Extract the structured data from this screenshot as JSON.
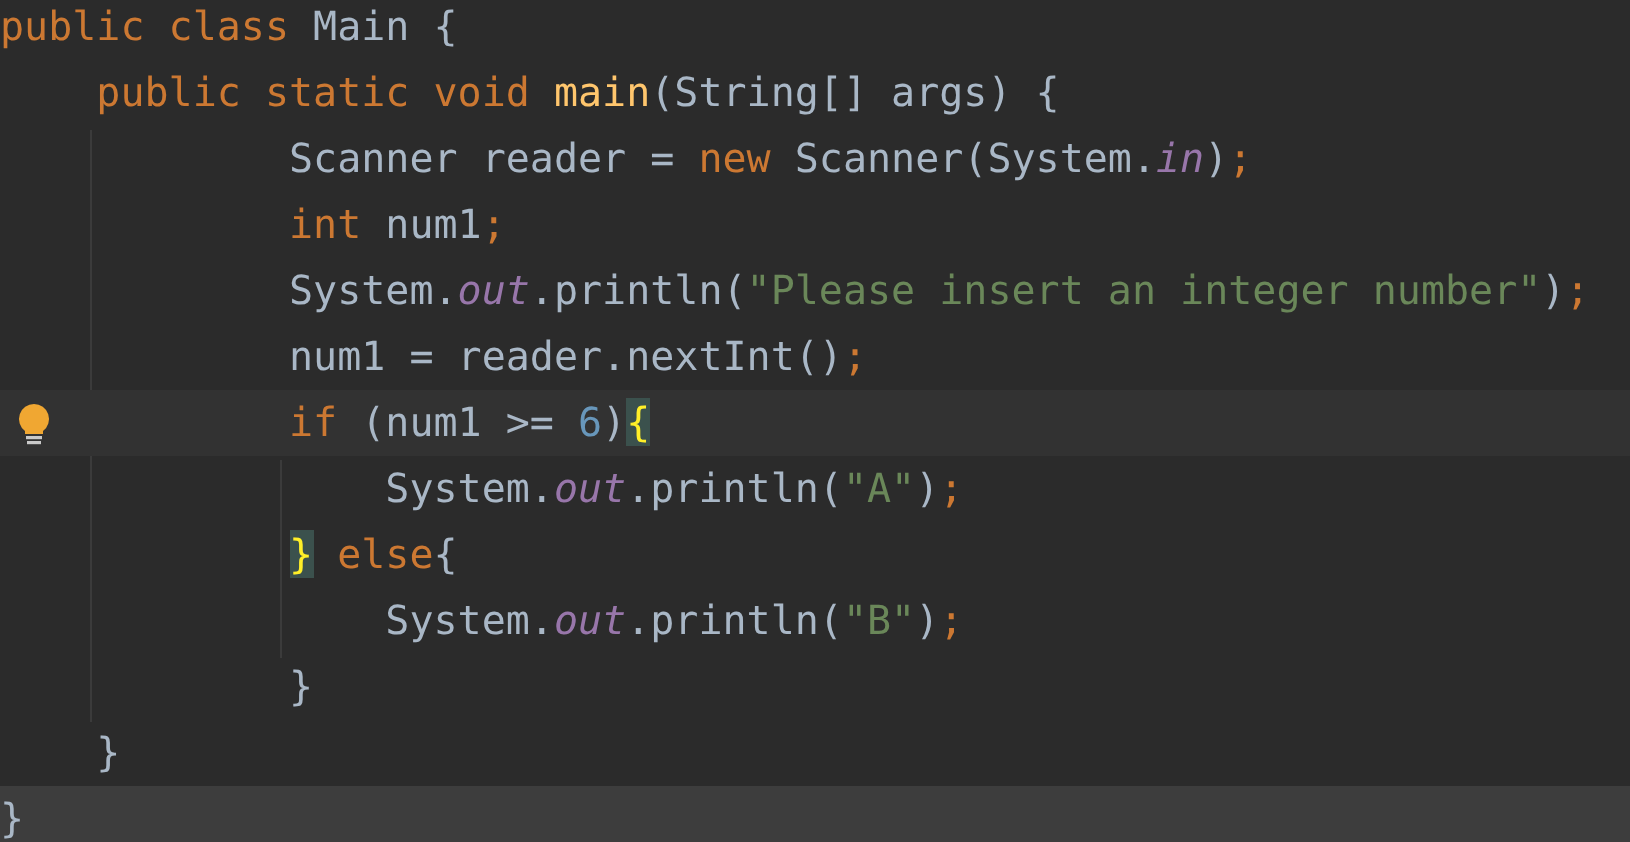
{
  "editor": {
    "lines": [
      {
        "current": false,
        "selected": false,
        "intention": false,
        "tokens": [
          {
            "kind": "keyword",
            "text": "public class "
          },
          {
            "kind": "plain",
            "text": "Main {"
          }
        ]
      },
      {
        "current": false,
        "selected": false,
        "intention": false,
        "tokens": [
          {
            "kind": "keyword",
            "text": "    public static void "
          },
          {
            "kind": "method",
            "text": "main"
          },
          {
            "kind": "plain",
            "text": "(String[] args) {"
          }
        ]
      },
      {
        "current": false,
        "selected": false,
        "intention": false,
        "tokens": [
          {
            "kind": "plain",
            "text": "            Scanner reader = "
          },
          {
            "kind": "keyword",
            "text": "new "
          },
          {
            "kind": "plain",
            "text": "Scanner(System."
          },
          {
            "kind": "field",
            "text": "in"
          },
          {
            "kind": "plain",
            "text": ")"
          },
          {
            "kind": "semicolon",
            "text": ";"
          }
        ]
      },
      {
        "current": false,
        "selected": false,
        "intention": false,
        "tokens": [
          {
            "kind": "keyword",
            "text": "            int "
          },
          {
            "kind": "plain",
            "text": "num1"
          },
          {
            "kind": "semicolon",
            "text": ";"
          }
        ]
      },
      {
        "current": false,
        "selected": false,
        "intention": false,
        "tokens": [
          {
            "kind": "plain",
            "text": "            System."
          },
          {
            "kind": "field",
            "text": "out"
          },
          {
            "kind": "plain",
            "text": ".println("
          },
          {
            "kind": "string",
            "text": "\"Please insert an integer number\""
          },
          {
            "kind": "plain",
            "text": ")"
          },
          {
            "kind": "semicolon",
            "text": ";"
          }
        ]
      },
      {
        "current": false,
        "selected": false,
        "intention": false,
        "tokens": [
          {
            "kind": "plain",
            "text": "            num1 = reader.nextInt()"
          },
          {
            "kind": "semicolon",
            "text": ";"
          }
        ]
      },
      {
        "current": true,
        "selected": false,
        "intention": true,
        "tokens": [
          {
            "kind": "keyword",
            "text": "            if "
          },
          {
            "kind": "plain",
            "text": "(num1 >= "
          },
          {
            "kind": "number",
            "text": "6"
          },
          {
            "kind": "plain",
            "text": ")"
          },
          {
            "kind": "match",
            "text": "{"
          }
        ]
      },
      {
        "current": false,
        "selected": false,
        "intention": false,
        "tokens": [
          {
            "kind": "plain",
            "text": "                System."
          },
          {
            "kind": "field",
            "text": "out"
          },
          {
            "kind": "plain",
            "text": ".println("
          },
          {
            "kind": "string",
            "text": "\"A\""
          },
          {
            "kind": "plain",
            "text": ")"
          },
          {
            "kind": "semicolon",
            "text": ";"
          }
        ]
      },
      {
        "current": false,
        "selected": false,
        "intention": false,
        "tokens": [
          {
            "kind": "match",
            "text": "            }"
          },
          {
            "kind": "keyword",
            "text": " else"
          },
          {
            "kind": "plain",
            "text": "{"
          }
        ]
      },
      {
        "current": false,
        "selected": false,
        "intention": false,
        "tokens": [
          {
            "kind": "plain",
            "text": "                System."
          },
          {
            "kind": "field",
            "text": "out"
          },
          {
            "kind": "plain",
            "text": ".println("
          },
          {
            "kind": "string",
            "text": "\"B\""
          },
          {
            "kind": "plain",
            "text": ")"
          },
          {
            "kind": "semicolon",
            "text": ";"
          }
        ]
      },
      {
        "current": false,
        "selected": false,
        "intention": false,
        "tokens": [
          {
            "kind": "plain",
            "text": "            }"
          }
        ]
      },
      {
        "current": false,
        "selected": false,
        "intention": false,
        "tokens": [
          {
            "kind": "plain",
            "text": "    }"
          }
        ]
      },
      {
        "current": false,
        "selected": true,
        "intention": false,
        "tokens": [
          {
            "kind": "plain",
            "text": "}"
          }
        ]
      }
    ]
  }
}
